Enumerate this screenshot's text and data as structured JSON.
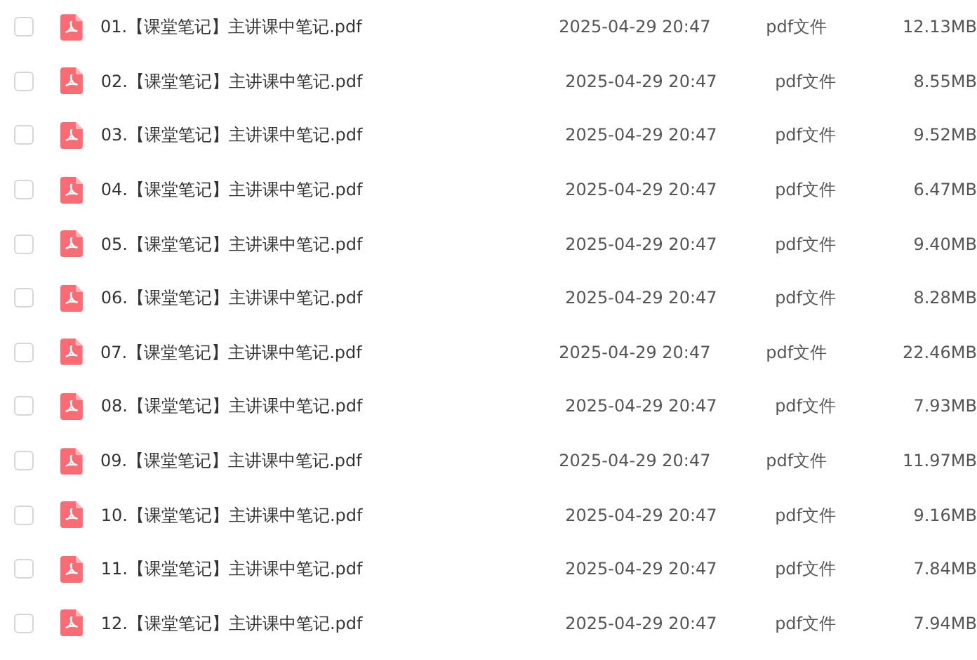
{
  "files": [
    {
      "checked": false,
      "name": "01.【课堂笔记】主讲课中笔记.pdf",
      "modified": "2025-04-29 20:47",
      "type": "pdf文件",
      "size": "12.13MB"
    },
    {
      "checked": false,
      "name": "02.【课堂笔记】主讲课中笔记.pdf",
      "modified": "2025-04-29 20:47",
      "type": "pdf文件",
      "size": "8.55MB"
    },
    {
      "checked": false,
      "name": "03.【课堂笔记】主讲课中笔记.pdf",
      "modified": "2025-04-29 20:47",
      "type": "pdf文件",
      "size": "9.52MB"
    },
    {
      "checked": false,
      "name": "04.【课堂笔记】主讲课中笔记.pdf",
      "modified": "2025-04-29 20:47",
      "type": "pdf文件",
      "size": "6.47MB"
    },
    {
      "checked": false,
      "name": "05.【课堂笔记】主讲课中笔记.pdf",
      "modified": "2025-04-29 20:47",
      "type": "pdf文件",
      "size": "9.40MB"
    },
    {
      "checked": false,
      "name": "06.【课堂笔记】主讲课中笔记.pdf",
      "modified": "2025-04-29 20:47",
      "type": "pdf文件",
      "size": "8.28MB"
    },
    {
      "checked": false,
      "name": "07.【课堂笔记】主讲课中笔记.pdf",
      "modified": "2025-04-29 20:47",
      "type": "pdf文件",
      "size": "22.46MB"
    },
    {
      "checked": false,
      "name": "08.【课堂笔记】主讲课中笔记.pdf",
      "modified": "2025-04-29 20:47",
      "type": "pdf文件",
      "size": "7.93MB"
    },
    {
      "checked": false,
      "name": "09.【课堂笔记】主讲课中笔记.pdf",
      "modified": "2025-04-29 20:47",
      "type": "pdf文件",
      "size": "11.97MB"
    },
    {
      "checked": false,
      "name": "10.【课堂笔记】主讲课中笔记.pdf",
      "modified": "2025-04-29 20:47",
      "type": "pdf文件",
      "size": "9.16MB"
    },
    {
      "checked": false,
      "name": "11.【课堂笔记】主讲课中笔记.pdf",
      "modified": "2025-04-29 20:47",
      "type": "pdf文件",
      "size": "7.84MB"
    },
    {
      "checked": false,
      "name": "12.【课堂笔记】主讲课中笔记.pdf",
      "modified": "2025-04-29 20:47",
      "type": "pdf文件",
      "size": "7.94MB"
    }
  ]
}
